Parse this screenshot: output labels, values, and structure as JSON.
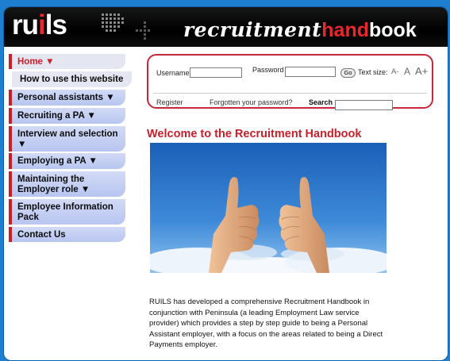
{
  "header": {
    "logo": {
      "part1": "ru",
      "highlight": "i",
      "part2": "ls"
    },
    "title": {
      "script": "recruitment",
      "hand": "hand",
      "book": "book"
    }
  },
  "nav": {
    "items": [
      {
        "label": "Home ▼",
        "active": true
      },
      {
        "label": "How to use this website",
        "sub": true
      },
      {
        "label": "Personal assistants ▼"
      },
      {
        "label": "Recruiting a PA ▼"
      },
      {
        "label": "Interview and selection ▼"
      },
      {
        "label": "Employing a PA ▼"
      },
      {
        "label": "Maintaining the Employer role ▼"
      },
      {
        "label": "Employee Information Pack"
      },
      {
        "label": "Contact Us"
      }
    ]
  },
  "login": {
    "username_label": "Username",
    "username_value": "",
    "password_label": "Password",
    "password_value": "",
    "go_label": "Go",
    "text_size_label": "Text size:",
    "text_sizes": [
      "A-",
      "A",
      "A+"
    ],
    "register_link": "Register",
    "forgot_link": "Forgotten your password?",
    "search_label": "Search",
    "search_value": ""
  },
  "main": {
    "heading": "Welcome to the Recruitment Handbook",
    "intro": "RUILS has developed a comprehensive Recruitment Handbook in conjunction with Peninsula (a leading Employment Law service provider) which provides a step by step guide to being a Personal Assistant employer, with a focus on the areas related to being a Direct Payments employer."
  },
  "colors": {
    "brand_red": "#c8202a",
    "nav_blue": "#b7c5f0",
    "page_blue": "#1e7fd0"
  },
  "icons": [
    "dot-matrix-logo-icon",
    "thumbs-up-photo"
  ]
}
